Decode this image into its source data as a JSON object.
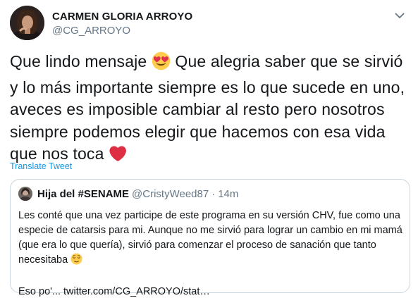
{
  "tweet": {
    "display_name": "CARMEN GLORIA ARROYO",
    "handle": "@CG_ARROYO",
    "text_part1": "Que lindo mensaje ",
    "text_part2": " Que alegria saber que se sirvió y lo más importante siempre es lo que sucede en uno, aveces es imposible cambiar al resto pero nosotros siempre podemos elegir que hacemos con esa vida que nos toca ",
    "translate_label": "Translate Tweet",
    "icons": {
      "menu": "chevron-down-icon",
      "emoji_1": "heart-eyes-emoji-icon",
      "emoji_2": "red-heart-emoji-icon"
    }
  },
  "quoted": {
    "display_name": "Hija del #SENAME",
    "handle": "@CristyWeed87",
    "separator": "·",
    "time": "14m",
    "text_part1": "Les conté que una vez participe de este programa en su versión CHV, fue como una especie de catarsis para mi. Aunque no me sirvió  para lograr un cambio en mi mamá (que era lo que quería), sirvió para comenzar el proceso de sanación que tanto necesitaba ",
    "text_part2": "Eso po'... twitter.com/CG_ARROYO/stat…",
    "icons": {
      "emoji": "relieved-face-emoji-icon"
    }
  },
  "colors": {
    "link": "#1b95e0",
    "secondary_text": "#657786",
    "border": "#ccd6dd",
    "text": "#14171a"
  }
}
